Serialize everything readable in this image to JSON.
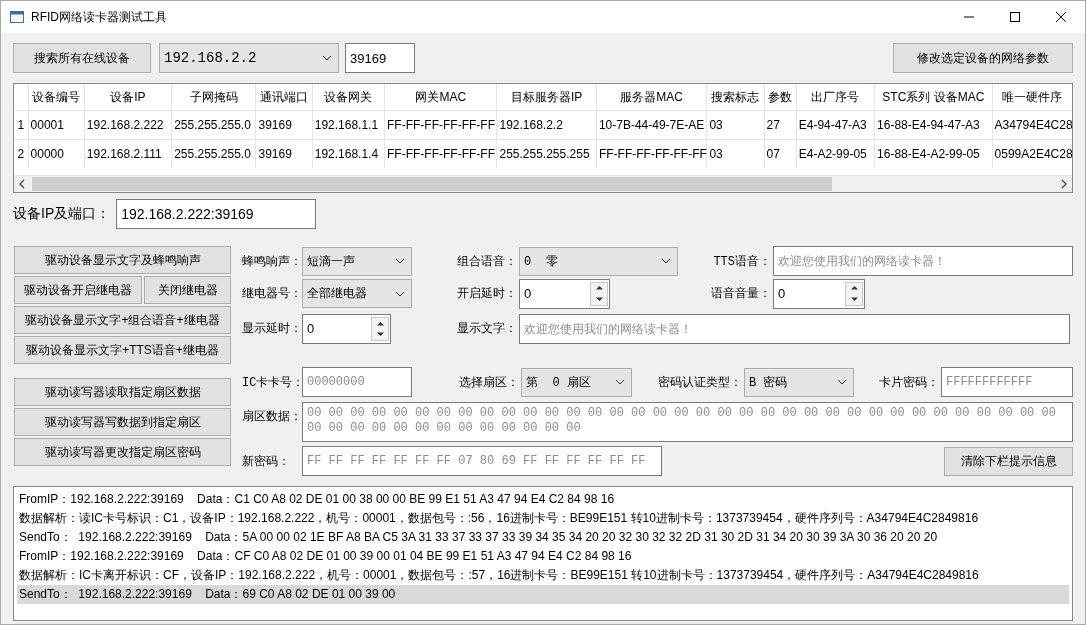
{
  "window": {
    "title": "RFID网络读卡器测试工具"
  },
  "toolbar": {
    "search_button": "搜索所有在线设备",
    "ip_combo": "192.168.2.2",
    "port": "39169",
    "modify_button": "修改选定设备的网络参数"
  },
  "device_table": {
    "columns": [
      "设备编号",
      "设备IP",
      "子网掩码",
      "通讯端口",
      "设备网关",
      "网关MAC",
      "目标服务器IP",
      "服务器MAC",
      "搜索标志",
      "参数",
      "出厂序号",
      "STC系列 设备MAC",
      "唯一硬件序"
    ],
    "rows": [
      {
        "header": "1",
        "cells": [
          "00001",
          "192.168.2.222",
          "255.255.255.0",
          "39169",
          "192.168.1.1",
          "FF-FF-FF-FF-FF-FF",
          "192.168.2.2",
          "10-7B-44-49-7E-AE",
          "03",
          "27",
          "E4-94-47-A3",
          "16-88-E4-94-47-A3",
          "A34794E4C28"
        ]
      },
      {
        "header": "2",
        "cells": [
          "00000",
          "192.168.2.111",
          "255.255.255.0",
          "39169",
          "192.168.1.4",
          "FF-FF-FF-FF-FF-FF",
          "255.255.255.255",
          "FF-FF-FF-FF-FF-FF",
          "03",
          "07",
          "E4-A2-99-05",
          "16-88-E4-A2-99-05",
          "0599A2E4C28"
        ]
      }
    ]
  },
  "device_address": {
    "label": "设备IP及端口：",
    "value": "192.168.2.222:39169"
  },
  "device_buttons": {
    "display_beep": "驱动设备显示文字及蜂鸣响声",
    "relay_on": "驱动设备开启继电器",
    "relay_off": "关闭继电器",
    "display_voice_relay": "驱动设备显示文字+组合语音+继电器",
    "display_tts_relay": "驱动设备显示文字+TTS语音+继电器"
  },
  "device_params": {
    "beep_label": "蜂鸣响声：",
    "beep_value": "短滴一声",
    "voice_label": "组合语音：",
    "voice_value": "0  零",
    "tts_label": "TTS语音：",
    "tts_placeholder": "欢迎您使用我们的网络读卡器！",
    "relay_label": "继电器号：",
    "relay_value": "全部继电器",
    "open_delay_label": "开启延时：",
    "open_delay_value": "0",
    "volume_label": "语音音量：",
    "volume_value": "0",
    "display_delay_label": "显示延时：",
    "display_delay_value": "0",
    "display_text_label": "显示文字：",
    "display_text_placeholder": "欢迎您使用我们的网络读卡器！"
  },
  "card_buttons": {
    "read": "驱动读写器读取指定扇区数据",
    "write": "驱动读写器写数据到指定扇区",
    "change_password": "驱动读写器更改指定扇区密码"
  },
  "card_params": {
    "card_no_label": "IC卡卡号：",
    "card_no_placeholder": "00000000",
    "sector_label": "选择扇区：",
    "sector_value": "第  0 扇区",
    "auth_label": "密码认证类型：",
    "auth_value": "B 密码",
    "card_password_label": "卡片密码：",
    "card_password_placeholder": "FFFFFFFFFFFF",
    "sector_data_label": "扇区数据：",
    "sector_data_placeholder": "00 00 00 00 00 00 00 00 00 00 00 00 00 00 00 00 00 00 00 00 00 00 00 00 00 00 00 00 00 00 00 00 00 00 00 00 00 00 00 00 00 00 00 00 00 00 00 00",
    "new_password_label": "新密码：",
    "new_password_placeholder": "FF FF FF FF FF FF FF 07 80 69 FF FF FF FF FF FF"
  },
  "clear_button": "清除下栏提示信息",
  "log": [
    {
      "text": "FromIP：192.168.2.222:39169    Data：C1 C0 A8 02 DE 01 00 38 00 00 BE 99 E1 51 A3 47 94 E4 C2 84 98 16",
      "selected": false
    },
    {
      "text": "数据解析：读IC卡号标识：C1，设备IP：192.168.2.222，机号：00001，数据包号：:56，16进制卡号：BE99E151 转10进制卡号：1373739454，硬件序列号：A34794E4C2849816",
      "selected": false
    },
    {
      "text": "SendTo：  192.168.2.222:39169    Data：5A 00 00 02 1E BF A8 BA C5 3A 31 33 37 33 37 33 39 34 35 34 20 20 32 30 32 32 2D 31 30 2D 31 34 20 30 39 3A 30 36 20 20 20",
      "selected": false
    },
    {
      "text": "FromIP：192.168.2.222:39169    Data：CF C0 A8 02 DE 01 00 39 00 01 04 BE 99 E1 51 A3 47 94 E4 C2 84 98 16",
      "selected": false
    },
    {
      "text": "数据解析：IC卡离开标识：CF，设备IP：192.168.2.222，机号：00001，数据包号：:57，16进制卡号：BE99E151 转10进制卡号：1373739454，硬件序列号：A34794E4C2849816",
      "selected": false
    },
    {
      "text": "SendTo：  192.168.2.222:39169    Data：69 C0 A8 02 DE 01 00 39 00",
      "selected": true
    }
  ]
}
